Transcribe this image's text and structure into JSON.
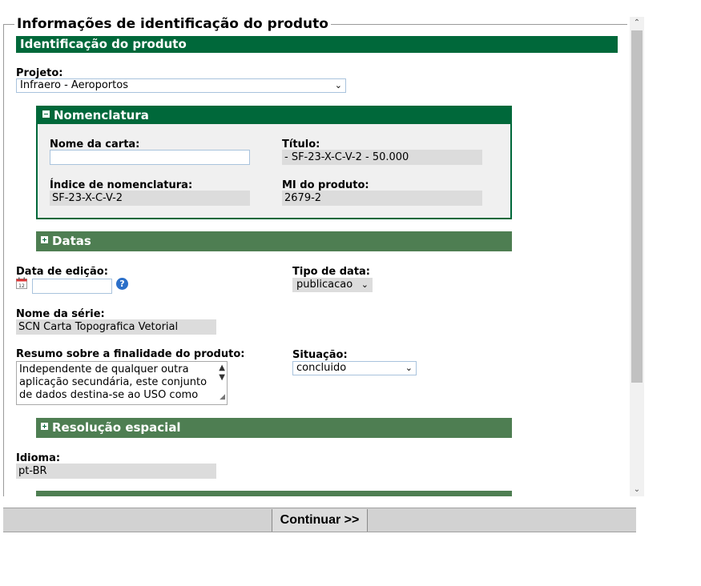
{
  "legend": "Informações de identificação do produto",
  "main_header": "Identificação do produto",
  "projeto": {
    "label": "Projeto:",
    "value": "Infraero - Aeroportos"
  },
  "nomenclatura": {
    "header": "Nomenclatura",
    "nome_carta_label": "Nome da carta:",
    "nome_carta_value": "",
    "titulo_label": "Título:",
    "titulo_value": " - SF-23-X-C-V-2 - 50.000",
    "indice_label": "Índice de nomenclatura:",
    "indice_value": "SF-23-X-C-V-2",
    "mi_label": "MI do produto:",
    "mi_value": "2679-2"
  },
  "datas_header": "Datas",
  "data_edicao": {
    "label": "Data de edição:",
    "value": ""
  },
  "tipo_data": {
    "label": "Tipo de data:",
    "value": "publicacao"
  },
  "nome_serie": {
    "label": "Nome da série:",
    "value": "SCN Carta Topografica Vetorial"
  },
  "resumo": {
    "label": "Resumo sobre a finalidade do produto:",
    "value": "Independente de qualquer outra aplicação secundária, este conjunto de dados destina-se ao USO como"
  },
  "situacao": {
    "label": "Situação:",
    "value": "concluido"
  },
  "resolucao_header": "Resolução espacial",
  "idioma": {
    "label": "Idioma:",
    "value": "pt-BR"
  },
  "continue_button": "Continuar >>",
  "colors": {
    "primary_green": "#00683a",
    "section_green": "#4e7e52",
    "readonly_grey": "#dcdcdc"
  }
}
